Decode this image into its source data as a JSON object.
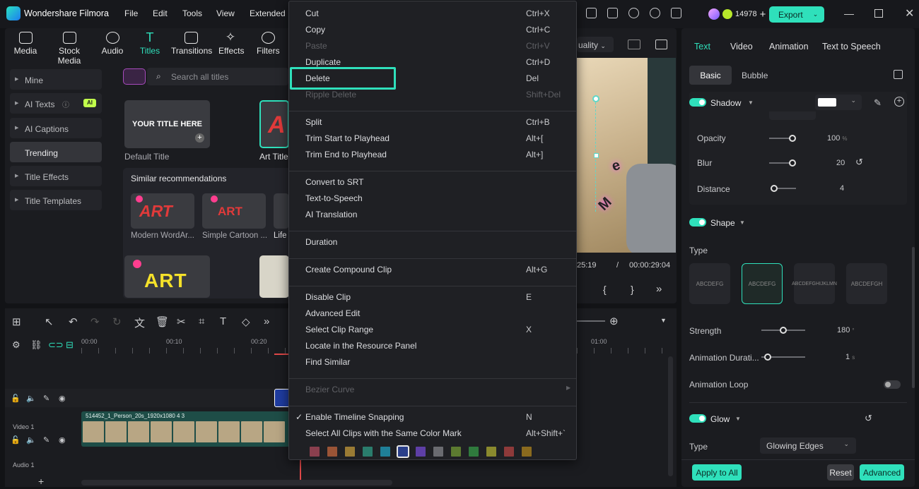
{
  "app": {
    "title": "Wondershare Filmora"
  },
  "menubar": [
    "File",
    "Edit",
    "Tools",
    "View",
    "Extended"
  ],
  "header": {
    "credits": "14978",
    "export_label": "Export"
  },
  "toolbar": [
    {
      "label": "Media",
      "icon": "media-icon"
    },
    {
      "label": "Stock Media",
      "icon": "stock-media-icon"
    },
    {
      "label": "Audio",
      "icon": "audio-icon"
    },
    {
      "label": "Titles",
      "icon": "titles-icon",
      "active": true
    },
    {
      "label": "Transitions",
      "icon": "transitions-icon"
    },
    {
      "label": "Effects",
      "icon": "effects-icon"
    },
    {
      "label": "Filters",
      "icon": "filters-icon"
    }
  ],
  "sidebar": [
    {
      "label": "Mine"
    },
    {
      "label": "AI Texts",
      "badge": "AI"
    },
    {
      "label": "AI Captions"
    },
    {
      "label": "Trending",
      "selected": true
    },
    {
      "label": "Title Effects"
    },
    {
      "label": "Title Templates"
    }
  ],
  "search": {
    "placeholder": "Search all titles"
  },
  "titles": {
    "default_card_text": "YOUR TITLE HERE",
    "default_label": "Default Title",
    "art_label": "Art Title",
    "similar_header": "Similar recommendations",
    "rec1_label": "Modern WordAr...",
    "rec2_label": "Simple Cartoon ...",
    "rec3_label": "Life",
    "art_text": "ART"
  },
  "preview": {
    "quality": "uality",
    "time_current": "25:19",
    "time_sep": "/",
    "time_total": "00:00:29:04"
  },
  "context_menu": {
    "groups": [
      [
        {
          "label": "Cut",
          "shortcut": "Ctrl+X"
        },
        {
          "label": "Copy",
          "shortcut": "Ctrl+C"
        },
        {
          "label": "Paste",
          "shortcut": "Ctrl+V",
          "disabled": true
        },
        {
          "label": "Duplicate",
          "shortcut": "Ctrl+D"
        },
        {
          "label": "Delete",
          "shortcut": "Del"
        },
        {
          "label": "Ripple Delete",
          "shortcut": "Shift+Del",
          "disabled": true
        }
      ],
      [
        {
          "label": "Split",
          "shortcut": "Ctrl+B"
        },
        {
          "label": "Trim Start to Playhead",
          "shortcut": "Alt+["
        },
        {
          "label": "Trim End to Playhead",
          "shortcut": "Alt+]"
        }
      ],
      [
        {
          "label": "Convert to SRT",
          "shortcut": ""
        },
        {
          "label": "Text-to-Speech",
          "shortcut": ""
        },
        {
          "label": "AI Translation",
          "shortcut": ""
        }
      ],
      [
        {
          "label": "Duration",
          "shortcut": ""
        }
      ],
      [
        {
          "label": "Create Compound Clip",
          "shortcut": "Alt+G"
        }
      ],
      [
        {
          "label": "Disable Clip",
          "shortcut": "E"
        },
        {
          "label": "Advanced Edit",
          "shortcut": ""
        },
        {
          "label": "Select Clip Range",
          "shortcut": "X"
        },
        {
          "label": "Locate in the Resource Panel",
          "shortcut": ""
        },
        {
          "label": "Find Similar",
          "shortcut": ""
        }
      ],
      [
        {
          "label": "Bezier Curve",
          "shortcut": "",
          "disabled": true,
          "submenu": true
        }
      ],
      [
        {
          "label": "Enable Timeline Snapping",
          "shortcut": "N",
          "checked": true
        },
        {
          "label": "Select All Clips with the Same Color Mark",
          "shortcut": "Alt+Shift+`"
        }
      ]
    ],
    "color_marks": [
      "#8a3f4e",
      "#9a5436",
      "#9a7b34",
      "#2a7c6c",
      "#1f7f98",
      "#2a3f8a",
      "#5e3fa6",
      "#6a6b70",
      "#5c7a30",
      "#2f7a3d",
      "#8a8a2e",
      "#8e3a3a",
      "#8a6a1e"
    ],
    "selected_color_index": 5
  },
  "right_panel": {
    "tabs": [
      "Text",
      "Video",
      "Animation",
      "Text to Speech"
    ],
    "subtabs": [
      "Basic",
      "Bubble"
    ],
    "shadow": {
      "title": "Shadow",
      "opacity_label": "Opacity",
      "opacity": "100",
      "opacity_unit": "%",
      "blur_label": "Blur",
      "blur": "20",
      "distance_label": "Distance",
      "distance": "4"
    },
    "shape": {
      "title": "Shape",
      "type_label": "Type",
      "strength_label": "Strength",
      "strength": "180",
      "strength_unit": "°",
      "anim_duration_label": "Animation Durati...",
      "anim_duration": "1",
      "anim_duration_unit": "s",
      "anim_loop_label": "Animation Loop",
      "shape_samples": [
        "ABCDEFG",
        "ABCDEFG",
        "ABCDEFGHIJKLMN",
        "ABCDEFGH"
      ]
    },
    "glow": {
      "title": "Glow",
      "type_label": "Type",
      "type_value": "Glowing Edges"
    },
    "footer": {
      "apply_all": "Apply to All",
      "reset": "Reset",
      "advanced": "Advanced"
    }
  },
  "timeline": {
    "ruler": [
      "00:00",
      "00:10",
      "00:20",
      "01:00"
    ],
    "video_track": "Video 1",
    "audio_track": "Audio 1",
    "clip_name": "514452_1_Person_20s_1920x1080 4 3"
  }
}
